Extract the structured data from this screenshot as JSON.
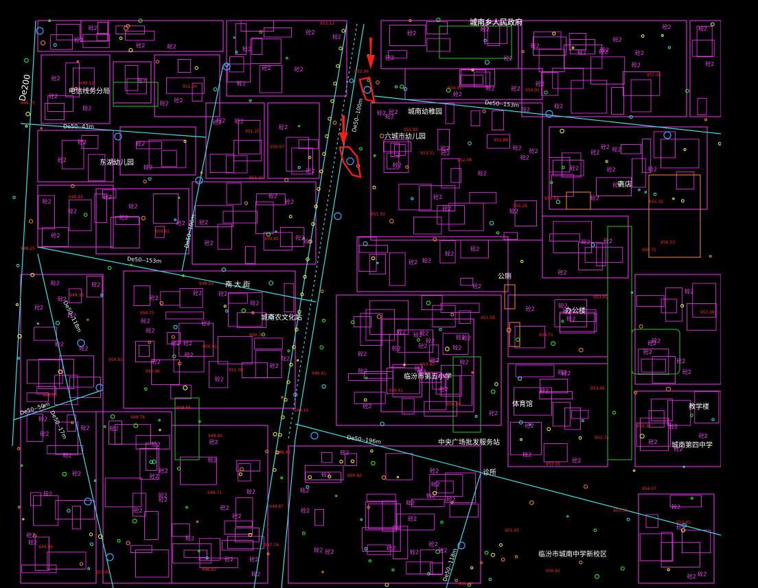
{
  "map": {
    "colors": {
      "background": "#000000",
      "building": "#ff33ff",
      "pipe": "#33e6e6",
      "elevation": "#ff2a2a",
      "vegetation": "#22cc22",
      "highlight": "#ff1a1a",
      "orange": "#ff8a33",
      "yellow": "#ffff33"
    },
    "places": {
      "township_gov": "城南乡人民政府",
      "telecom": "电信线务分局",
      "kindergarten_1": "东湖幼儿园",
      "kindergarten_2": "六城市幼儿园",
      "jiaozhi": "城南幼稚园",
      "culture": "城南农文化站",
      "school_5": "临汾市第五小学",
      "market": "中央广场批发服务站",
      "gym": "体育馆",
      "office": "办公楼",
      "teaching": "教学楼",
      "school_4": "城南第四中学",
      "middle_school": "临汾市城南中学新校区",
      "toilet": "公厕",
      "store": "商店",
      "clinic": "诊所",
      "road_name": "南 大 街"
    },
    "pipe_labels": {
      "de200": "De200",
      "de50_100_v": "De50--100m",
      "de50_100_left": "De50--100m",
      "de50_153_right": "De50--153m",
      "de50_43": "De50--43m",
      "de50_153_mid": "De50--153m",
      "de50_196": "De50--196m",
      "de50_118": "De50--118m",
      "de50_118_b": "De50--118m",
      "de50_50": "De50--50m",
      "de50_17": "De50--17m",
      "de50_118_c": "De50--118m"
    },
    "elevations": {
      "e1": "953.12",
      "e2": "952.96",
      "e3": "954.41",
      "e4": "954.91",
      "e5": "957.32",
      "e6": "949.12",
      "e7": "949.25",
      "e8": "951.94",
      "e9": "951.25",
      "e10": "951.83",
      "e11": "952.08",
      "e12": "950.97",
      "e13": "951.15",
      "e14": "952.88",
      "e15": "954.59",
      "e16": "955.32",
      "e17": "956.33",
      "e18": "949.83",
      "e19": "950.61",
      "e20": "951.50",
      "e21": "950.85",
      "e22": "949.29",
      "e23": "949.33",
      "e24": "949.25",
      "e25": "950.75",
      "e26": "950.33",
      "e27": "950.91",
      "e28": "951.58",
      "e29": "953.91",
      "e30": "954.71",
      "e31": "950.66",
      "e32": "951.38",
      "e33": "950.90",
      "e34": "949.41",
      "e35": "950.41",
      "e36": "950.58",
      "e37": "954.31",
      "e38": "953.74",
      "e39": "953.66",
      "e40": "953.16",
      "e41": "949.78",
      "e42": "949.66",
      "e43": "948.99",
      "e44": "949.92",
      "e45": "950.82",
      "e46": "949.19",
      "e47": "949.71",
      "e48": "951.40",
      "e49": "950.65",
      "e50": "953.37",
      "e51": "954.07",
      "e52": "953.65",
      "e53": "951.45",
      "e54": "950.91",
      "e55": "947.74",
      "e56": "943.99",
      "e57": "944.03",
      "e58": "949.87",
      "e59": "946.65",
      "e60": "953.99",
      "e61": "951.08",
      "e62": "955.24",
      "e63": "953.31",
      "e64": "950.71"
    },
    "building_label": "砼2"
  }
}
